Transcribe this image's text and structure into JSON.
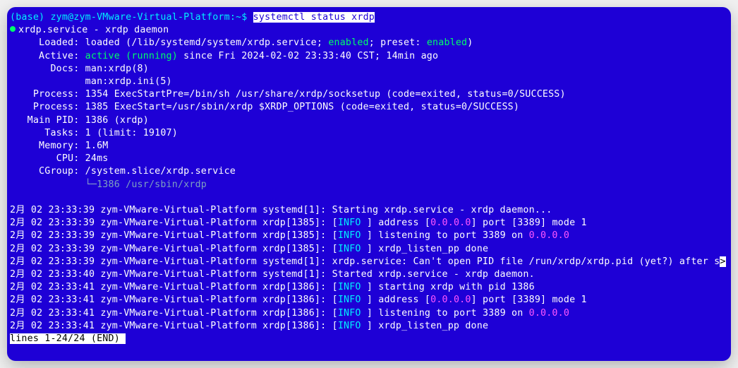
{
  "prompt": {
    "env": "(base)",
    "user_host": "zym@zym-VMware-Virtual-Platform",
    "cwd": ":~$",
    "command": "systemctl status xrdp"
  },
  "header": {
    "unit_line": "xrdp.service - xrdp daemon",
    "loaded_label": "     Loaded:",
    "loaded_value_a": " loaded (/lib/systemd/system/xrdp.service; ",
    "loaded_enabled1": "enabled",
    "loaded_value_b": "; preset: ",
    "loaded_enabled2": "enabled",
    "loaded_value_c": ")",
    "active_label": "     Active: ",
    "active_state": "active (running)",
    "active_since": " since Fri 2024-02-02 23:33:40 CST; 14min ago",
    "docs_label": "       Docs:",
    "docs1": " man:xrdp(8)",
    "docs2": "             man:xrdp.ini(5)",
    "process1": "    Process: 1354 ExecStartPre=/bin/sh /usr/share/xrdp/socksetup (code=exited, status=0/SUCCESS)",
    "process2": "    Process: 1385 ExecStart=/usr/sbin/xrdp $XRDP_OPTIONS (code=exited, status=0/SUCCESS)",
    "mainpid": "   Main PID: 1386 (xrdp)",
    "tasks": "      Tasks: 1 (limit: 19107)",
    "memory": "     Memory: 1.6M",
    "cpu": "        CPU: 24ms",
    "cgroup": "     CGroup: /system.slice/xrdp.service",
    "cgroup_child_prefix": "             └─",
    "cgroup_child": "1386 /usr/sbin/xrdp"
  },
  "logs": [
    {
      "ts": "2月 02 23:33:39 zym-VMware-Virtual-Platform systemd[1]: ",
      "info": false,
      "msg": "Starting xrdp.service - xrdp daemon..."
    },
    {
      "ts": "2月 02 23:33:39 zym-VMware-Virtual-Platform xrdp[1385]: ",
      "info": true,
      "addr": "0.0.0.0",
      "pre": "address [",
      "post": "] port [3389] mode 1"
    },
    {
      "ts": "2月 02 23:33:39 zym-VMware-Virtual-Platform xrdp[1385]: ",
      "info": true,
      "addr": "0.0.0.0",
      "pre": "listening to port 3389 on ",
      "post": ""
    },
    {
      "ts": "2月 02 23:33:39 zym-VMware-Virtual-Platform xrdp[1385]: ",
      "info": true,
      "msg": "xrdp_listen_pp done"
    },
    {
      "ts": "2月 02 23:33:39 zym-VMware-Virtual-Platform systemd[1]: ",
      "info": false,
      "msg": "xrdp.service: Can't open PID file /run/xrdp/xrdp.pid (yet?) after s",
      "trunc": ">"
    },
    {
      "ts": "2月 02 23:33:40 zym-VMware-Virtual-Platform systemd[1]: ",
      "info": false,
      "msg": "Started xrdp.service - xrdp daemon."
    },
    {
      "ts": "2月 02 23:33:41 zym-VMware-Virtual-Platform xrdp[1386]: ",
      "info": true,
      "msg": "starting xrdp with pid 1386"
    },
    {
      "ts": "2月 02 23:33:41 zym-VMware-Virtual-Platform xrdp[1386]: ",
      "info": true,
      "addr": "0.0.0.0",
      "pre": "address [",
      "post": "] port [3389] mode 1"
    },
    {
      "ts": "2月 02 23:33:41 zym-VMware-Virtual-Platform xrdp[1386]: ",
      "info": true,
      "addr": "0.0.0.0",
      "pre": "listening to port 3389 on ",
      "post": ""
    },
    {
      "ts": "2月 02 23:33:41 zym-VMware-Virtual-Platform xrdp[1386]: ",
      "info": true,
      "msg": "xrdp_listen_pp done"
    }
  ],
  "info_tag": {
    "open": "[",
    "label": "INFO ",
    "close": "] "
  },
  "pager": "lines 1-24/24 (END)"
}
